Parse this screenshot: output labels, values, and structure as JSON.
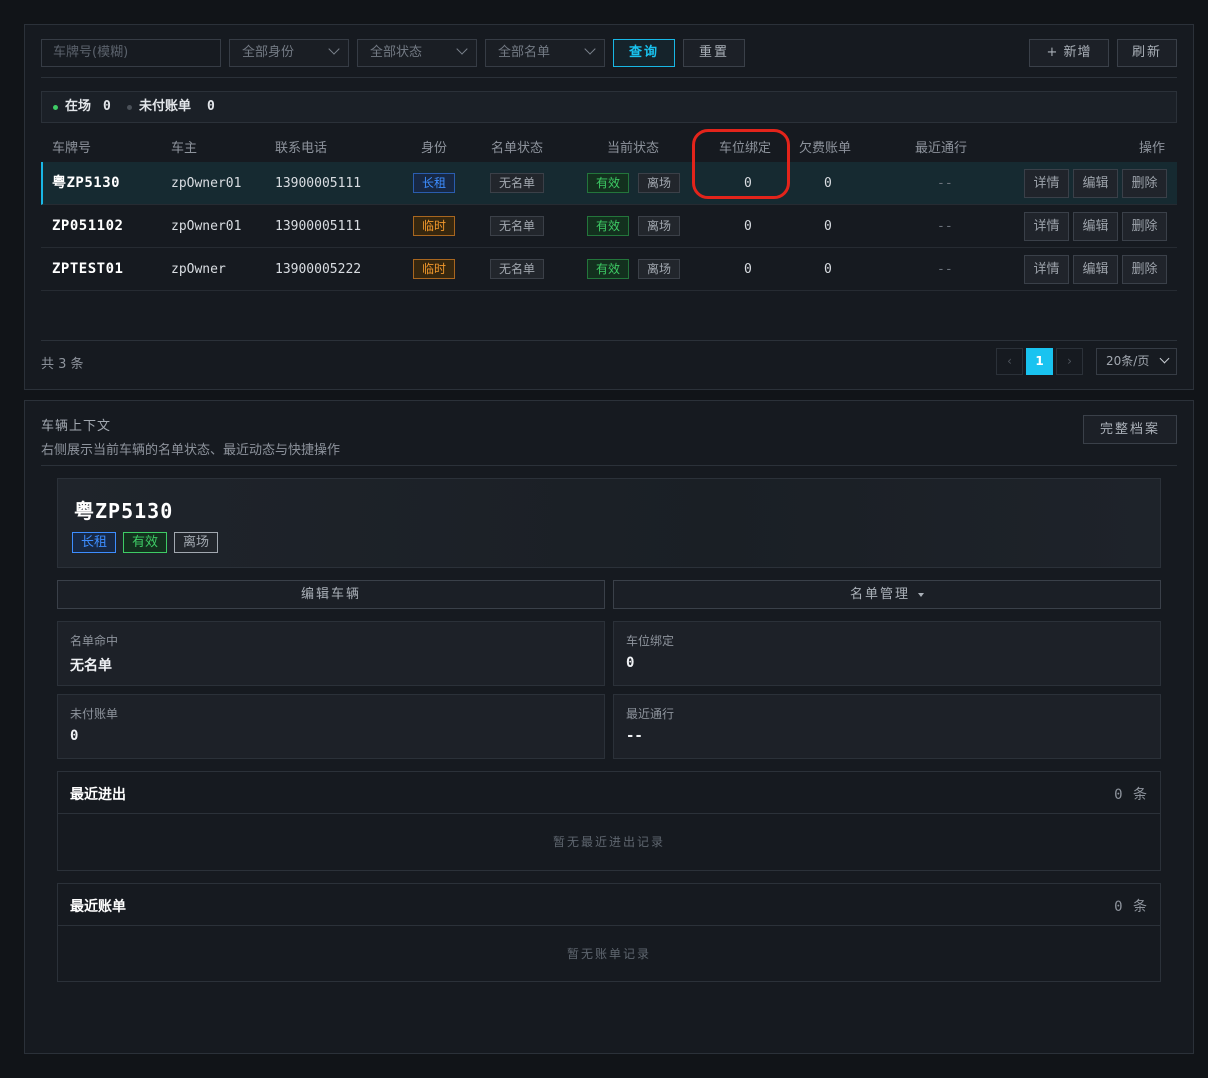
{
  "filters": {
    "plate_placeholder": "车牌号(模糊)",
    "identity_select": "全部身份",
    "status_select": "全部状态",
    "list_select": "全部名单",
    "query_label": "查询",
    "reset_label": "重置",
    "add_label": "+ 新增",
    "refresh_label": "刷新"
  },
  "stats": {
    "onsite_label": "在场",
    "onsite_value": "0",
    "unpaid_label": "未付账单",
    "unpaid_value": "0",
    "colors": {
      "onsite_dot": "#3ecb65",
      "unpaid_dot": "#4a5058"
    }
  },
  "table": {
    "headers": {
      "plate": "车牌号",
      "owner": "车主",
      "phone": "联系电话",
      "identity": "身份",
      "list_status": "名单状态",
      "current_status": "当前状态",
      "space_binding": "车位绑定",
      "arrears": "欠费账单",
      "last_pass": "最近通行",
      "actions": "操作"
    },
    "rows": [
      {
        "plate": "粤ZP5130",
        "owner": "zpOwner01",
        "phone": "13900005111",
        "identity": "长租",
        "list_status": "无名单",
        "validity": "有效",
        "presence": "离场",
        "space_binding": "0",
        "arrears": "0",
        "last_pass": "--",
        "selected": true
      },
      {
        "plate": "ZP051102",
        "owner": "zpOwner01",
        "phone": "13900005111",
        "identity": "临时",
        "list_status": "无名单",
        "validity": "有效",
        "presence": "离场",
        "space_binding": "0",
        "arrears": "0",
        "last_pass": "--",
        "selected": false
      },
      {
        "plate": "ZPTEST01",
        "owner": "zpOwner",
        "phone": "13900005222",
        "identity": "临时",
        "list_status": "无名单",
        "validity": "有效",
        "presence": "离场",
        "space_binding": "0",
        "arrears": "0",
        "last_pass": "--",
        "selected": false
      }
    ],
    "actions": {
      "detail": "详情",
      "edit": "编辑",
      "delete": "删除"
    }
  },
  "pagination": {
    "total_text": "共 3 条",
    "prev": "‹",
    "current_page": "1",
    "next": "›",
    "page_size": "20条/页"
  },
  "context": {
    "title": "车辆上下文",
    "subtitle": "右侧展示当前车辆的名单状态、最近动态与快捷操作",
    "full_profile_label": "完整档案",
    "plate": "粤ZP5130",
    "tags": {
      "identity": "长租",
      "validity": "有效",
      "presence": "离场"
    },
    "edit_vehicle_label": "编辑车辆",
    "list_manage_label": "名单管理",
    "info": {
      "list_hit_label": "名单命中",
      "list_hit_value": "无名单",
      "space_binding_label": "车位绑定",
      "space_binding_value": "0",
      "unpaid_label": "未付账单",
      "unpaid_value": "0",
      "last_pass_label": "最近通行",
      "last_pass_value": "--"
    },
    "recent_io": {
      "title": "最近进出",
      "count": "0 条",
      "empty": "暂无最近进出记录"
    },
    "recent_bills": {
      "title": "最近账单",
      "count": "0 条",
      "empty": "暂无账单记录"
    }
  },
  "theme": {
    "accent": "#19c3f0",
    "highlight_ring": "#e3241b",
    "tag_blue": "#3d8dff",
    "tag_orange": "#f0972b",
    "tag_green": "#3ecb65"
  }
}
